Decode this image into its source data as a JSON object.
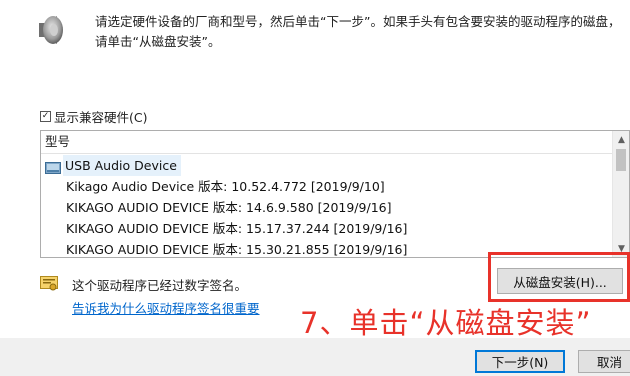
{
  "instruction": {
    "line1": "请选定硬件设备的厂商和型号，然后单击“下一步”。如果手头有包含要安装的驱动程序的磁盘，",
    "line2": "请单击“从磁盘安装”。"
  },
  "compatible": {
    "label": "显示兼容硬件(C)",
    "checked": true
  },
  "model_list": {
    "header": "型号",
    "group": "USB Audio Device",
    "items": [
      "Kikago Audio Device 版本: 10.52.4.772 [2019/9/10]",
      "KIKAGO AUDIO DEVICE 版本: 14.6.9.580 [2019/9/16]",
      "KIKAGO AUDIO DEVICE 版本: 15.17.37.244 [2019/9/16]",
      "KIKAGO AUDIO DEVICE 版本: 15.30.21.855 [2019/9/16]"
    ]
  },
  "signature": {
    "signed_text": "这个驱动程序已经过数字签名。",
    "why_link": "告诉我为什么驱动程序签名很重要"
  },
  "buttons": {
    "have_disk": "从磁盘安装(H)...",
    "next": "下一步(N)",
    "cancel": "取消"
  },
  "annotation": "7、单击“从磁盘安装”",
  "colors": {
    "accent_blue": "#0078d7",
    "selection": "#e5f1fb",
    "annotation_red": "#e8322a",
    "link": "#0066cc"
  }
}
